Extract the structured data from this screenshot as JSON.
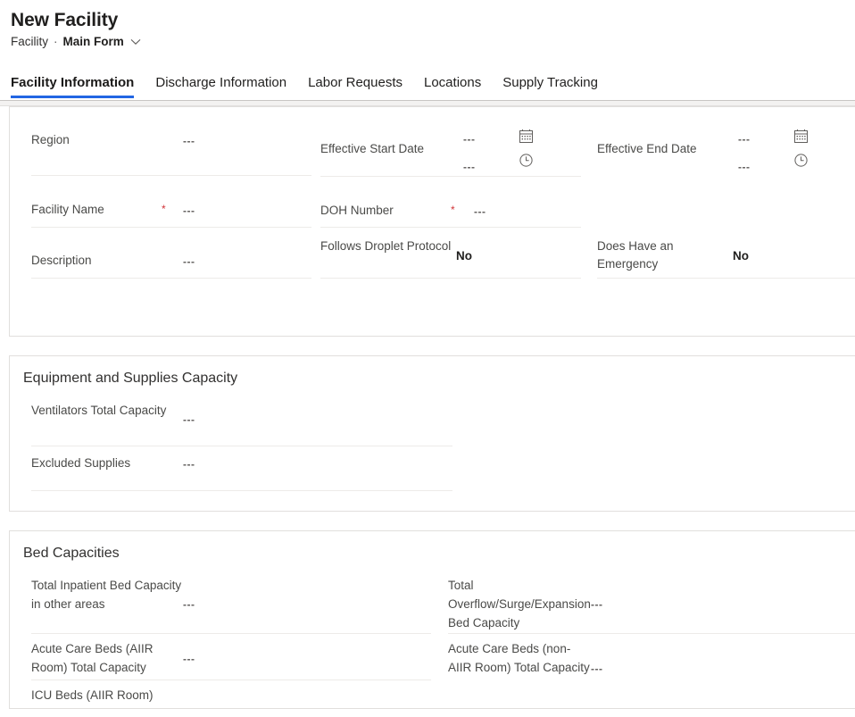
{
  "header": {
    "record_title": "New Facility",
    "entity_name": "Facility",
    "separator": "·",
    "form_name": "Main Form",
    "chevron_icon": "chevron-down-icon"
  },
  "tabs": [
    {
      "label": "Facility Information",
      "active": true
    },
    {
      "label": "Discharge Information",
      "active": false
    },
    {
      "label": "Labor Requests",
      "active": false
    },
    {
      "label": "Locations",
      "active": false
    },
    {
      "label": "Supply Tracking",
      "active": false
    }
  ],
  "placeholder": "---",
  "required_marker": "*",
  "sections": {
    "general": {
      "title": "",
      "left_fields": [
        {
          "label": "Region",
          "value": "---",
          "required": false
        },
        {
          "label": "Facility Name",
          "value": "---",
          "required": true
        },
        {
          "label": "Description",
          "value": "---",
          "required": false
        }
      ],
      "mid_fields": [
        {
          "label": "Effective Start Date",
          "value_date": "---",
          "value_time": "---",
          "date_icon": "calendar-icon",
          "time_icon": "clock-icon"
        },
        {
          "label": "DOH Number",
          "value": "---",
          "required": true
        },
        {
          "label": "Follows Droplet Protocol",
          "value": "No"
        }
      ],
      "right_fields": [
        {
          "label": "Effective End Date",
          "value_date": "---",
          "value_time": "---",
          "date_icon": "calendar-icon",
          "time_icon": "clock-icon"
        },
        {
          "label": "Does Have an Emergency",
          "value": "No"
        }
      ]
    },
    "equipment": {
      "title": "Equipment and Supplies Capacity",
      "fields": [
        {
          "label": "Ventilators Total Capacity",
          "value": "---"
        },
        {
          "label": "Excluded Supplies",
          "value": "---"
        }
      ]
    },
    "beds": {
      "title": "Bed Capacities",
      "left_fields": [
        {
          "label": "Total Inpatient Bed Capacity in other areas",
          "value": "---"
        },
        {
          "label": "Acute Care Beds (AIIR Room) Total Capacity",
          "value": "---"
        },
        {
          "label": "ICU Beds (AIIR Room)",
          "value": ""
        }
      ],
      "right_fields": [
        {
          "label": "Total Overflow/Surge/Expansion Bed Capacity",
          "value": "---"
        },
        {
          "label": "Acute Care Beds (non-AIIR Room) Total Capacity",
          "value": "---"
        }
      ]
    }
  },
  "colors": {
    "accent": "#2266e3",
    "required": "#d13438",
    "label": "#4a4a48",
    "border": "#e1dfdd",
    "rule": "#edebe9"
  }
}
